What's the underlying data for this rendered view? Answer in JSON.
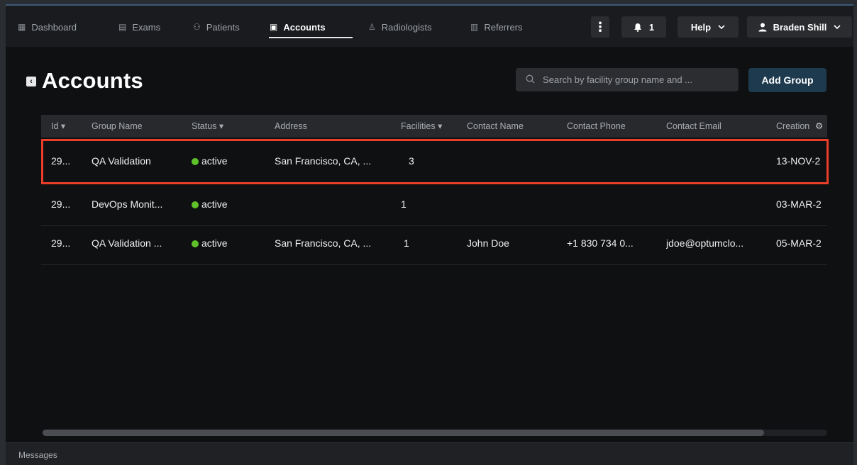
{
  "nav": {
    "items": [
      {
        "label": "Dashboard",
        "icon": "▦"
      },
      {
        "label": "Exams",
        "icon": "▤"
      },
      {
        "label": "Patients",
        "icon": "⚇"
      },
      {
        "label": "Accounts",
        "icon": "▣"
      },
      {
        "label": "Radiologists",
        "icon": "♙"
      },
      {
        "label": "Referrers",
        "icon": "▥"
      }
    ],
    "menu_icon": "⋮",
    "notifications_count": "1",
    "help_label": "Help",
    "user_name": "Braden Shill"
  },
  "page": {
    "title": "Accounts",
    "search_placeholder": "Search by facility group name and ...",
    "add_group_label": "Add Group"
  },
  "table": {
    "headers": [
      "Id ▾",
      "Group Name",
      "Status ▾",
      "Address",
      "Facilities ▾",
      "Contact Name",
      "Contact Phone",
      "Contact Email",
      "Creation"
    ],
    "rows": [
      {
        "id": "29...",
        "group_name": "QA Validation",
        "status": "active",
        "address": "San Francisco, CA, ...",
        "facilities": "3",
        "contact_name": "",
        "contact_phone": "",
        "contact_email": "",
        "creation": "13-NOV-2"
      },
      {
        "id": "29...",
        "group_name": "DevOps Monit...",
        "status": "active",
        "address": "",
        "facilities": "1",
        "contact_name": "",
        "contact_phone": "",
        "contact_email": "",
        "creation": "03-MAR-2"
      },
      {
        "id": "29...",
        "group_name": "QA Validation ...",
        "status": "active",
        "address": "San Francisco, CA, ...",
        "facilities": "1",
        "contact_name": "John Doe",
        "contact_phone": "+1 830 734 0...",
        "contact_email": "jdoe@optumclo...",
        "creation": "05-MAR-2"
      }
    ]
  },
  "scrollbar": {
    "thumb_fraction": 0.92
  },
  "footer": {
    "messages_label": "Messages"
  },
  "colors": {
    "active_dot": "#5ec228",
    "highlight": "#ea3d2a",
    "add_button": "#1e3a4f"
  }
}
